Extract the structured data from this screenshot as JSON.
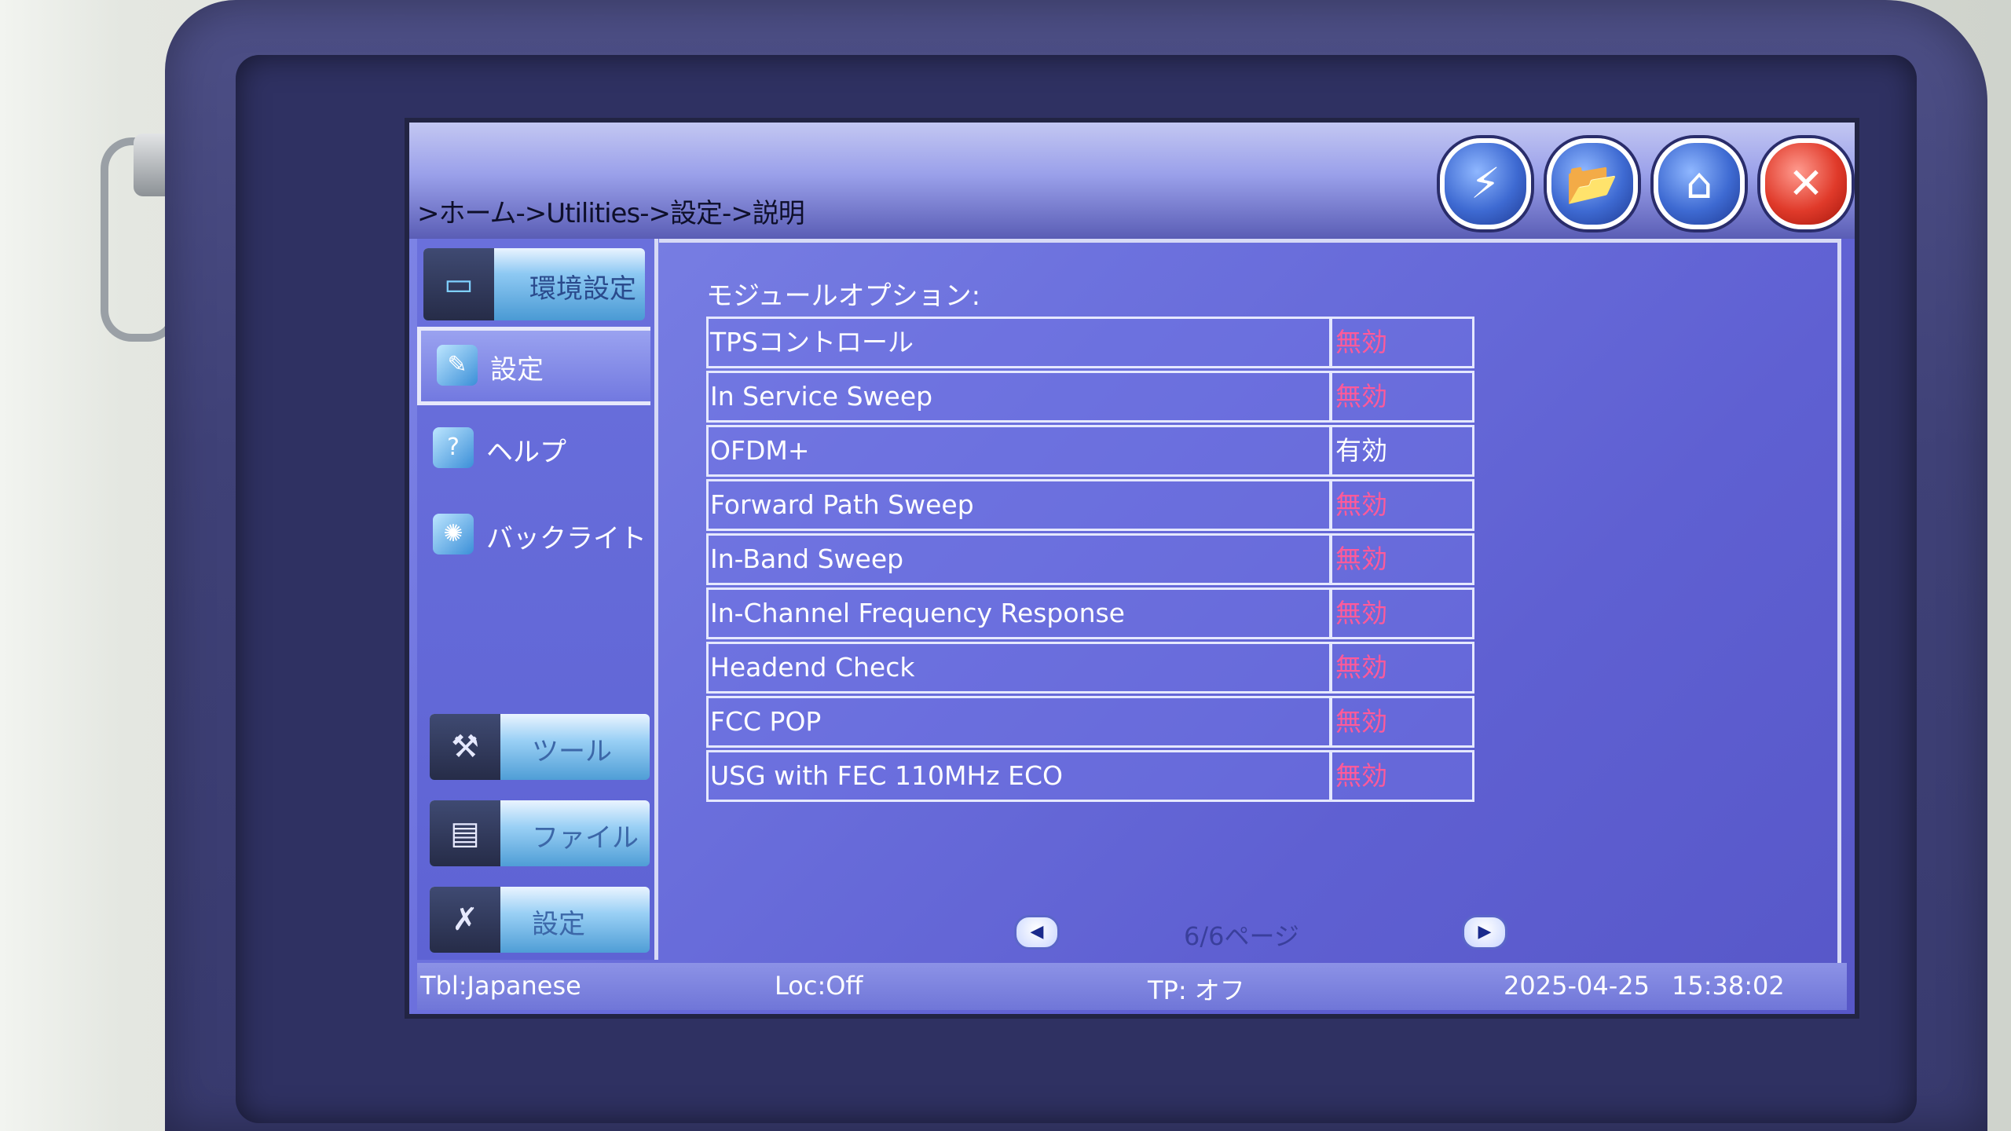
{
  "breadcrumb": ">ホーム->Utilities->設定->説明",
  "top_buttons": [
    {
      "name": "measure-icon",
      "glyph": "⚡"
    },
    {
      "name": "folder-icon",
      "glyph": "📂"
    },
    {
      "name": "home-icon",
      "glyph": "⌂"
    },
    {
      "name": "close-icon",
      "glyph": "✕"
    }
  ],
  "sidebar": {
    "top_button": "環境設定",
    "items": [
      {
        "label": "設定",
        "active": true
      },
      {
        "label": "ヘルプ",
        "active": false
      },
      {
        "label": "バックライト",
        "active": false
      }
    ],
    "tools": [
      {
        "label": "ツール"
      },
      {
        "label": "ファイル"
      },
      {
        "label": "設定"
      }
    ]
  },
  "main": {
    "title": "モジュールオプション:",
    "options": [
      {
        "name": "TPSコントロール",
        "status": "無効",
        "enabled": false
      },
      {
        "name": "In Service Sweep",
        "status": "無効",
        "enabled": false
      },
      {
        "name": "OFDM+",
        "status": "有効",
        "enabled": true
      },
      {
        "name": "Forward Path Sweep",
        "status": "無効",
        "enabled": false
      },
      {
        "name": "In-Band Sweep",
        "status": "無効",
        "enabled": false
      },
      {
        "name": "In-Channel Frequency Response",
        "status": "無効",
        "enabled": false
      },
      {
        "name": "Headend Check",
        "status": "無効",
        "enabled": false
      },
      {
        "name": "FCC POP",
        "status": "無効",
        "enabled": false
      },
      {
        "name": "USG with FEC 110MHz ECO",
        "status": "無効",
        "enabled": false
      }
    ],
    "pager": "6/6ページ"
  },
  "statusbar": {
    "tbl": "Tbl:Japanese",
    "loc": "Loc:Off",
    "tp": "TP: オフ",
    "date": "2025-04-25",
    "time": "15:38:02"
  },
  "colors": {
    "enabled_status": "#ffffff",
    "disabled_status": "#ff5a9a",
    "screen_bg": "#6d72de"
  }
}
